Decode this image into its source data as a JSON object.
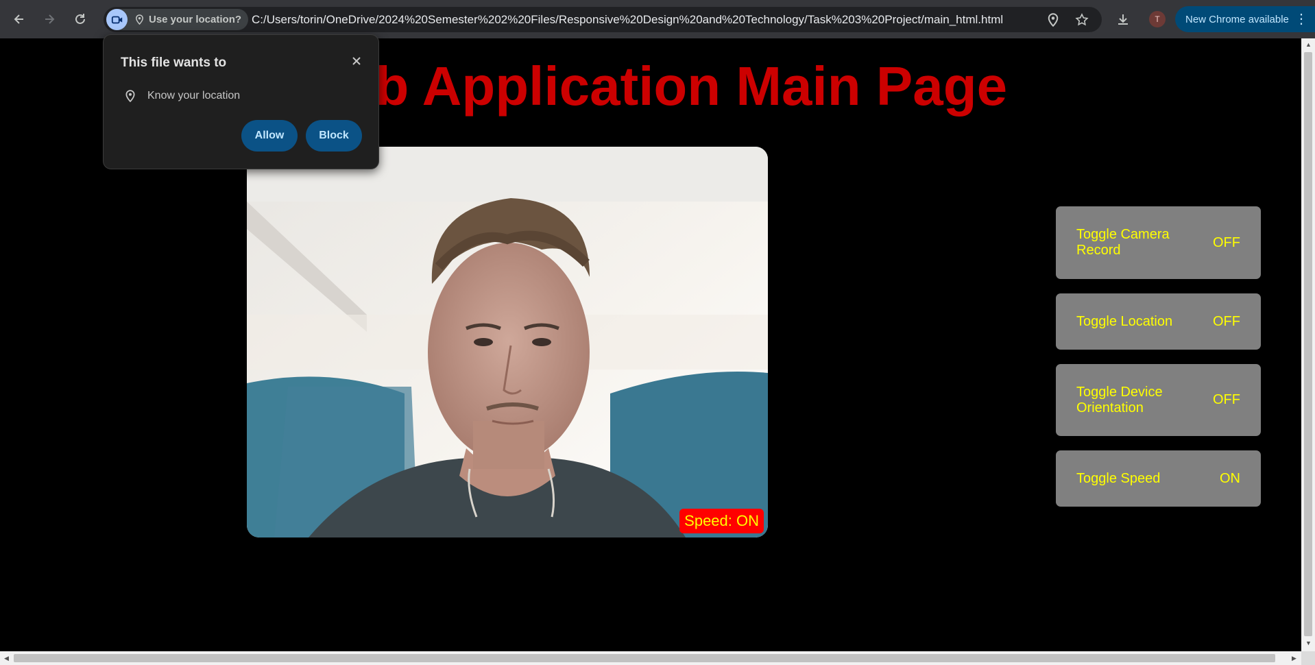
{
  "browser": {
    "location_chip": "Use your location?",
    "url": "C:/Users/torin/OneDrive/2024%20Semester%202%20Files/Responsive%20Design%20and%20Technology/Task%203%20Project/main_html.html",
    "avatar_initial": "T",
    "update_label": "New Chrome available"
  },
  "popup": {
    "title": "This file wants to",
    "permission": "Know your location",
    "allow_label": "Allow",
    "block_label": "Block"
  },
  "page": {
    "title": "Web Application Main Page",
    "speed_overlay": "Speed: ON",
    "controls": [
      {
        "label": "Toggle Camera Record",
        "state": "OFF"
      },
      {
        "label": "Toggle Location",
        "state": "OFF"
      },
      {
        "label": "Toggle Device Orientation",
        "state": "OFF"
      },
      {
        "label": "Toggle Speed",
        "state": "ON"
      }
    ]
  },
  "colors": {
    "title": "#cc0000",
    "button_bg": "#808080",
    "button_text": "#ffff00",
    "speed_badge_bg": "#ff0000"
  }
}
